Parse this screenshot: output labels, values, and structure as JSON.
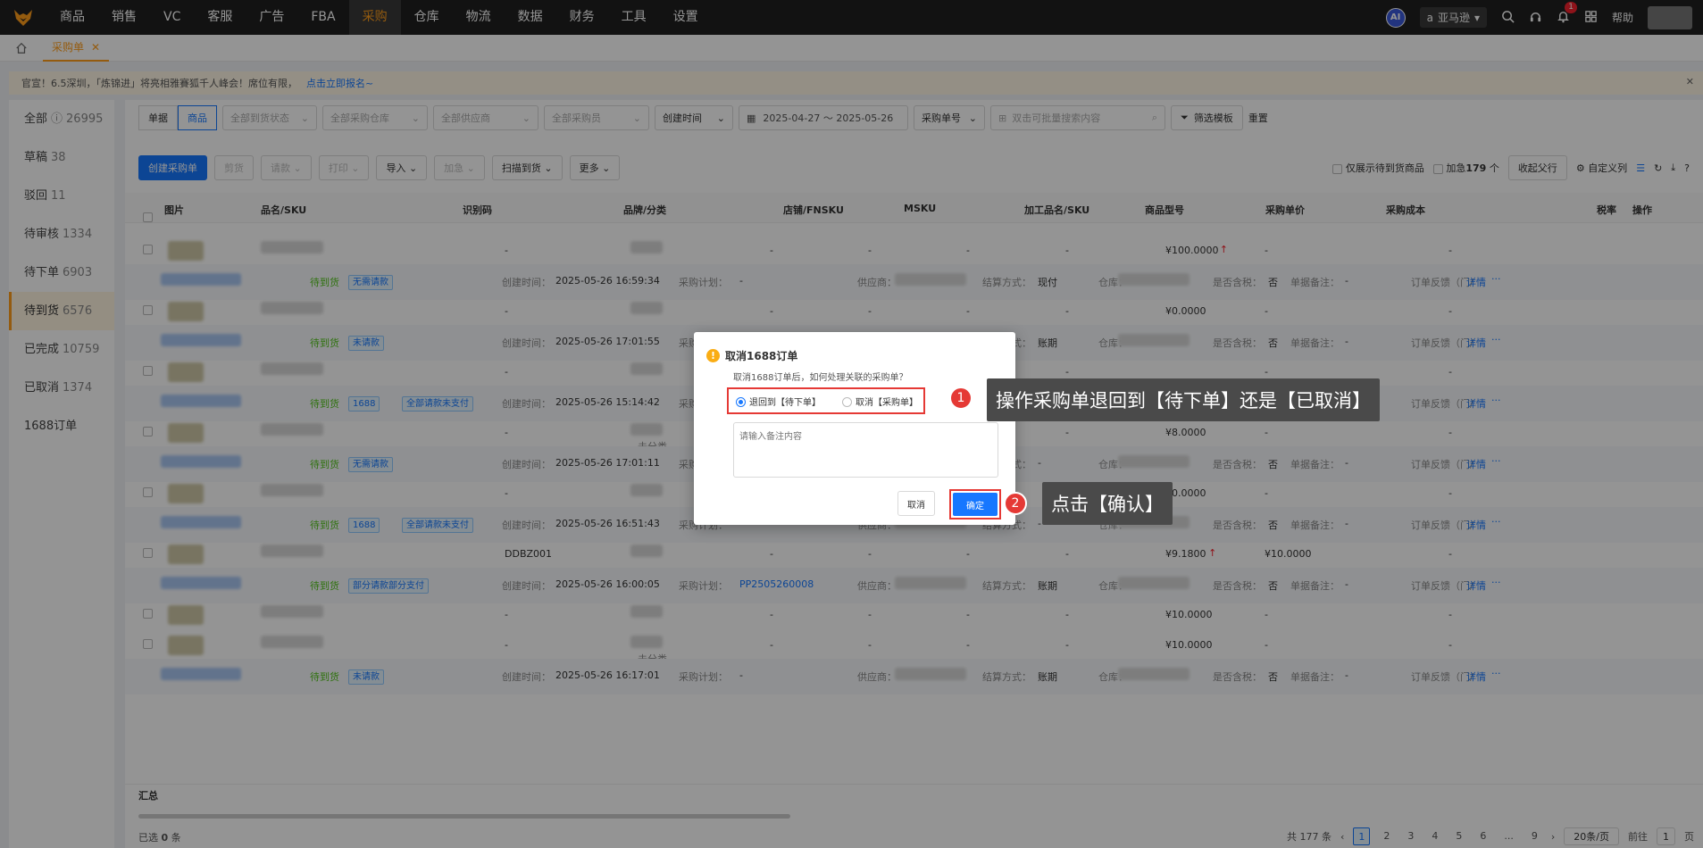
{
  "topnav": {
    "items": [
      "商品",
      "销售",
      "VC",
      "客服",
      "广告",
      "FBA",
      "采购",
      "仓库",
      "物流",
      "数据",
      "财务",
      "工具",
      "设置"
    ],
    "active": "采购",
    "ai_label": "AI",
    "platform": "亚马逊",
    "bell_count": "1",
    "help": "帮助"
  },
  "tabbar": {
    "tab_label": "采购单"
  },
  "announcement": {
    "text": "官宣！6.5深圳，「炼锦进」将亮相雅賽狐千人峰会！席位有限，",
    "link": "点击立即报名~"
  },
  "sidebar": {
    "items": [
      {
        "label": "全部",
        "count": "26995"
      },
      {
        "label": "草稿",
        "count": "38"
      },
      {
        "label": "驳回",
        "count": "11"
      },
      {
        "label": "待审核",
        "count": "1334"
      },
      {
        "label": "待下单",
        "count": "6903"
      },
      {
        "label": "待到货",
        "count": "6576"
      },
      {
        "label": "已完成",
        "count": "10759"
      },
      {
        "label": "已取消",
        "count": "1374"
      },
      {
        "label": "1688订单",
        "count": ""
      }
    ]
  },
  "filters": {
    "seg1": "单据",
    "seg2": "商品",
    "arrival_status": "全部到货状态",
    "warehouse": "全部采购仓库",
    "supplier": "全部供应商",
    "buyer": "全部采购员",
    "time_type": "创建时间",
    "date_range": "2025-04-27 ～ 2025-05-26",
    "search_type": "采购单号",
    "search_placeholder": "双击可批量搜索内容",
    "template": "筛选模板",
    "reset": "重置"
  },
  "actions": {
    "create": "创建采购单",
    "cut": "剪货",
    "request": "请款",
    "print": "打印",
    "import": "导入",
    "urgent": "加急",
    "scan": "扫描到货",
    "more": "更多",
    "only_pending": "仅展示待到货商品",
    "urgent_prefix": "加急",
    "urgent_count": "179",
    "urgent_suffix": "个",
    "collapse": "收起父行",
    "custom_cols": "自定义列"
  },
  "table": {
    "headers": [
      "图片",
      "品名/SKU",
      "识别码",
      "品牌/分类",
      "店铺/FNSKU",
      "MSKU",
      "加工品名/SKU",
      "商品型号",
      "采购单价",
      "采购成本",
      "税率",
      "操作"
    ],
    "group_rows": [
      {
        "status": "待到货",
        "tags": [
          "无需请款"
        ],
        "time": "2025-05-26 16:59:34",
        "plan": "-",
        "settle": "现付",
        "tax": "否",
        "note": "-"
      },
      {
        "status": "待到货",
        "tags": [
          "未请款"
        ],
        "time": "2025-05-26 17:01:55",
        "plan": "-",
        "settle": "账期",
        "tax": "否",
        "note": "-"
      },
      {
        "status": "待到货",
        "tags": [
          "1688",
          "全部请款未支付"
        ],
        "time": "2025-05-26 15:14:42",
        "plan": "-",
        "settle": "-",
        "tax": "否",
        "note": "-"
      },
      {
        "status": "待到货",
        "tags": [
          "无需请款"
        ],
        "time": "2025-05-26 17:01:11",
        "plan": "-",
        "settle": "-",
        "tax": "否",
        "note": "-"
      },
      {
        "status": "待到货",
        "tags": [
          "1688",
          "全部请款未支付"
        ],
        "time": "2025-05-26 16:51:43",
        "plan": "-",
        "settle": "-",
        "tax": "否",
        "note": "-"
      },
      {
        "status": "待到货",
        "tags": [
          "部分请款部分支付"
        ],
        "time": "2025-05-26 16:00:05",
        "plan": "PP2505260008",
        "settle": "账期",
        "tax": "否",
        "note": "-"
      },
      {
        "status": "待到货",
        "tags": [
          "未请款"
        ],
        "time": "2025-05-26 16:17:01",
        "plan": "-",
        "settle": "账期",
        "tax": "否",
        "note": "-"
      }
    ],
    "item_rows": [
      {
        "code": "-",
        "price": "¥100.0000",
        "cost": "-",
        "up": true,
        "cat": ""
      },
      {
        "code": "-",
        "price": "¥0.0000",
        "cost": "-",
        "up": false,
        "cat": ""
      },
      {
        "code": "-",
        "price": "",
        "cost": "-",
        "up": false,
        "cat": ""
      },
      {
        "code": "-",
        "price": "¥8.0000",
        "cost": "-",
        "up": false,
        "cat": "未分类"
      },
      {
        "code": "-",
        "price": "¥0.0000",
        "cost": "-",
        "up": false,
        "cat": ""
      },
      {
        "code": "DDBZ001",
        "price": "¥9.1800",
        "cost": "¥10.0000",
        "up": true,
        "cat": ""
      },
      {
        "code": "-",
        "price": "¥10.0000",
        "cost": "-",
        "up": false,
        "cat": ""
      },
      {
        "code": "-",
        "price": "¥10.0000",
        "cost": "-",
        "up": false,
        "cat": "未分类"
      }
    ],
    "labels": {
      "created": "创建时间：",
      "plan": "采购计划：",
      "supplier": "供应商：",
      "settle": "结算方式：",
      "warehouse": "仓库：",
      "tax": "是否含税：",
      "note": "单据备注：",
      "feedback": "订单反馈（门/",
      "detail": "详情",
      "more": "···"
    }
  },
  "footer": {
    "total": "汇总",
    "selected_prefix": "已选",
    "selected_count": "0",
    "selected_suffix": "条",
    "total_prefix": "共",
    "total_count": "177",
    "total_suffix": "条",
    "pages": [
      "1",
      "2",
      "3",
      "4",
      "5",
      "6",
      "...",
      "9"
    ],
    "page_size": "20条/页",
    "goto": "前往",
    "goto_page": "1",
    "goto_suffix": "页"
  },
  "modal": {
    "title": "取消1688订单",
    "desc": "取消1688订单后，如何处理关联的采购单？",
    "option1": "退回到【待下单】",
    "option2": "取消【采购单】",
    "remark_placeholder": "请输入备注内容",
    "cancel": "取消",
    "ok": "确定"
  },
  "annotations": {
    "step1": "1",
    "step1_text": "操作采购单退回到【待下单】还是【已取消】",
    "step2": "2",
    "step2_text": "点击【确认】"
  },
  "colors": {
    "accent": "#ff9e1b",
    "primary": "#1677ff",
    "highlight": "#e53935"
  }
}
